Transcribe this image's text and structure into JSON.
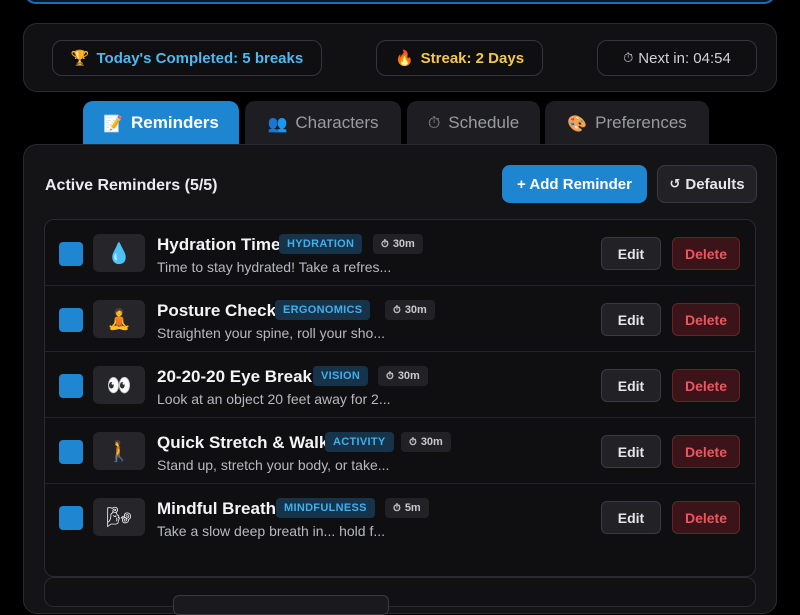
{
  "stats": {
    "completed": {
      "icon": "🏆",
      "label": "Today's Completed: 5 breaks"
    },
    "streak": {
      "icon": "🔥",
      "label": "Streak: 2 Days"
    },
    "next": {
      "icon": "⏱",
      "label": "Next in: 04:54"
    }
  },
  "tabs": [
    {
      "icon": "📝",
      "label": "Reminders",
      "active": true
    },
    {
      "icon": "👥",
      "label": "Characters",
      "active": false
    },
    {
      "icon": "⏱",
      "label": "Schedule",
      "active": false
    },
    {
      "icon": "🎨",
      "label": "Preferences",
      "active": false
    }
  ],
  "section": {
    "title": "Active Reminders (5/5)",
    "add_label": "+ Add Reminder",
    "defaults_icon": "↺",
    "defaults_label": "Defaults"
  },
  "duration_icon": "⏱",
  "row_actions": {
    "edit": "Edit",
    "delete": "Delete"
  },
  "reminders": [
    {
      "checked": true,
      "icon": "💧",
      "name": "Hydration Time",
      "category": "HYDRATION",
      "duration": "30m",
      "description": "Time to stay hydrated! Take a refres..."
    },
    {
      "checked": true,
      "icon": "🧘",
      "name": "Posture Check",
      "category": "ERGONOMICS",
      "duration": "30m",
      "description": "Straighten your spine, roll your sho..."
    },
    {
      "checked": true,
      "icon": "👀",
      "name": "20-20-20 Eye Break",
      "category": "VISION",
      "duration": "30m",
      "description": "Look at an object 20 feet away for 2..."
    },
    {
      "checked": true,
      "icon": "🚶",
      "name": "Quick Stretch & Walk",
      "category": "ACTIVITY",
      "duration": "30m",
      "description": "Stand up, stretch your body, or take..."
    },
    {
      "checked": true,
      "icon": "🌬",
      "name": "Mindful Breath",
      "category": "MINDFULNESS",
      "duration": "5m",
      "description": "Take a slow deep breath in... hold f..."
    }
  ]
}
